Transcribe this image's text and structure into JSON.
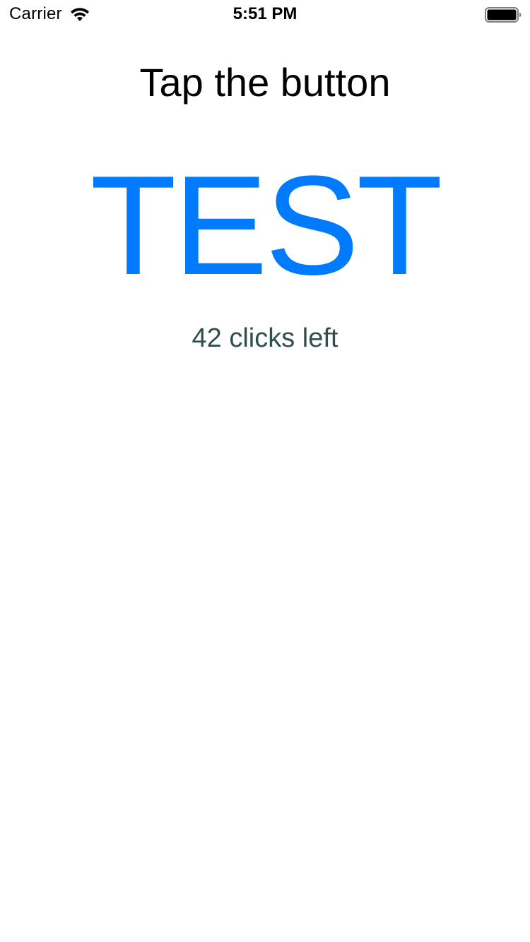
{
  "status_bar": {
    "carrier": "Carrier",
    "time": "5:51 PM",
    "wifi_icon": "wifi-icon",
    "battery_icon": "battery-full-icon"
  },
  "main": {
    "title": "Tap the button",
    "button_label": "TEST",
    "clicks_left_text": "42 clicks left"
  },
  "colors": {
    "accent": "#007aff",
    "counter_text": "#2f4f4f",
    "background": "#ffffff"
  }
}
